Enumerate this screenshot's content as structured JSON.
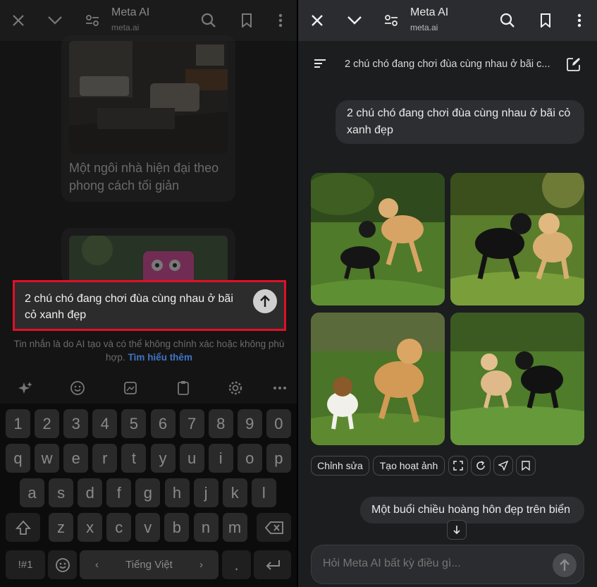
{
  "left": {
    "header": {
      "title": "Meta AI",
      "subtitle": "meta.ai"
    },
    "card1_caption": "Một ngôi nhà hiện đại theo phong cách tối giản",
    "prompt_text": "2 chú chó đang chơi đùa cùng nhau ở bãi cỏ xanh đẹp",
    "disclaimer": "Tin nhắn là do AI tạo và có thể không chính xác hoặc không phù hợp.",
    "disclaimer_link": "Tìm hiểu thêm",
    "keyboard": {
      "row_numbers": [
        "1",
        "2",
        "3",
        "4",
        "5",
        "6",
        "7",
        "8",
        "9",
        "0"
      ],
      "row1": [
        "q",
        "w",
        "e",
        "r",
        "t",
        "y",
        "u",
        "i",
        "o",
        "p"
      ],
      "row2": [
        "a",
        "s",
        "d",
        "f",
        "g",
        "h",
        "j",
        "k",
        "l"
      ],
      "row3": [
        "z",
        "x",
        "c",
        "v",
        "b",
        "n",
        "m"
      ],
      "symbols_key": "!#1",
      "language": "Tiếng Việt",
      "period": ".",
      "lang_left": "‹",
      "lang_right": "›"
    }
  },
  "right": {
    "header": {
      "title": "Meta AI",
      "subtitle": "meta.ai"
    },
    "chat_title": "2 chú chó đang chơi đùa cùng nhau ở bãi c...",
    "user_message": "2 chú chó đang chơi đùa cùng nhau ở bãi cỏ xanh đẹp",
    "actions": {
      "edit": "Chỉnh sửa",
      "animate": "Tạo hoạt ảnh"
    },
    "suggestion": "Một buổi chiều hoàng hôn đẹp trên biển",
    "ask_placeholder": "Hỏi Meta AI bất kỳ điều gì..."
  },
  "colors": {
    "highlight": "#e0102a",
    "link": "#3f75c4",
    "grass": "#4f7a2a"
  }
}
